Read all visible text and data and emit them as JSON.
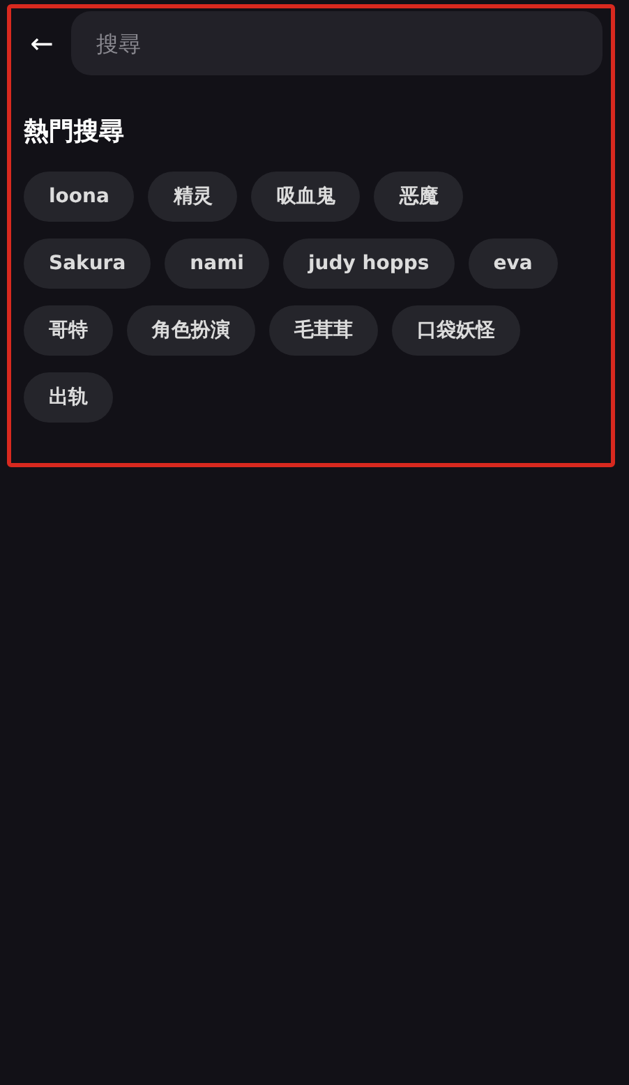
{
  "search": {
    "back_label": "←",
    "placeholder": "搜尋"
  },
  "hot_search": {
    "title": "熱門搜尋",
    "tags": [
      "loona",
      "精灵",
      "吸血鬼",
      "恶魔",
      "Sakura",
      "nami",
      "judy hopps",
      "eva",
      "哥特",
      "角色扮演",
      "毛茸茸",
      "口袋妖怪",
      "出轨"
    ]
  }
}
